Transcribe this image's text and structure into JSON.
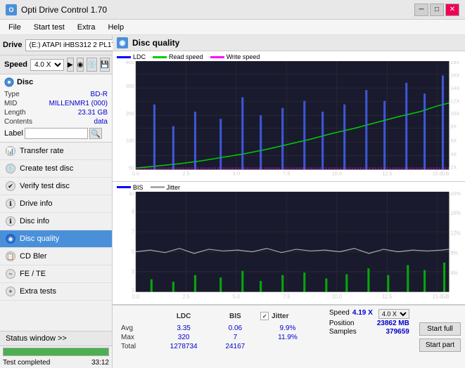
{
  "titlebar": {
    "title": "Opti Drive Control 1.70",
    "icon": "O",
    "controls": [
      "minimize",
      "maximize",
      "close"
    ]
  },
  "menubar": {
    "items": [
      "File",
      "Start test",
      "Extra",
      "Help"
    ]
  },
  "drive": {
    "label": "Drive",
    "value": "(E:)  ATAPI iHBS312  2 PL17",
    "speed_label": "Speed",
    "speed_value": "4.0 X"
  },
  "disc": {
    "type_label": "Type",
    "type_value": "BD-R",
    "mid_label": "MID",
    "mid_value": "MILLENMR1 (000)",
    "length_label": "Length",
    "length_value": "23.31 GB",
    "contents_label": "Contents",
    "contents_value": "data",
    "label_label": "Label",
    "label_value": ""
  },
  "nav_items": [
    {
      "id": "transfer-rate",
      "label": "Transfer rate",
      "active": false
    },
    {
      "id": "create-test-disc",
      "label": "Create test disc",
      "active": false
    },
    {
      "id": "verify-test-disc",
      "label": "Verify test disc",
      "active": false
    },
    {
      "id": "drive-info",
      "label": "Drive info",
      "active": false
    },
    {
      "id": "disc-info",
      "label": "Disc info",
      "active": false
    },
    {
      "id": "disc-quality",
      "label": "Disc quality",
      "active": true
    },
    {
      "id": "cd-bler",
      "label": "CD Bler",
      "active": false
    },
    {
      "id": "fe-te",
      "label": "FE / TE",
      "active": false
    },
    {
      "id": "extra-tests",
      "label": "Extra tests",
      "active": false
    }
  ],
  "status_window": {
    "label": "Status window >>",
    "progress": 100,
    "status_text": "Test completed",
    "time": "33:12"
  },
  "disc_quality": {
    "title": "Disc quality",
    "chart1": {
      "legend": [
        {
          "label": "LDC",
          "color": "#0000ff"
        },
        {
          "label": "Read speed",
          "color": "#00cc00"
        },
        {
          "label": "Write speed",
          "color": "#ff00ff"
        }
      ],
      "y_max": 400,
      "y_right_labels": [
        "18X",
        "16X",
        "14X",
        "12X",
        "10X",
        "8X",
        "6X",
        "4X",
        "2X"
      ],
      "x_max": 25
    },
    "chart2": {
      "legend": [
        {
          "label": "BIS",
          "color": "#0000ff"
        },
        {
          "label": "Jitter",
          "color": "#888888"
        }
      ],
      "y_max": 10,
      "y_right_labels": [
        "20%",
        "16%",
        "12%",
        "8%",
        "4%"
      ],
      "x_max": 25
    }
  },
  "stats": {
    "headers": [
      "",
      "LDC",
      "BIS",
      "",
      "Jitter",
      "Speed"
    ],
    "rows": [
      {
        "label": "Avg",
        "ldc": "3.35",
        "bis": "0.06",
        "jitter": "9.9%"
      },
      {
        "label": "Max",
        "ldc": "320",
        "bis": "7",
        "jitter": "11.9%"
      },
      {
        "label": "Total",
        "ldc": "1278734",
        "bis": "24167",
        "jitter": ""
      }
    ],
    "jitter_checked": true,
    "speed_value": "4.19 X",
    "speed_setting": "4.0 X",
    "position_label": "Position",
    "position_value": "23862 MB",
    "samples_label": "Samples",
    "samples_value": "379659",
    "start_full_label": "Start full",
    "start_part_label": "Start part"
  }
}
